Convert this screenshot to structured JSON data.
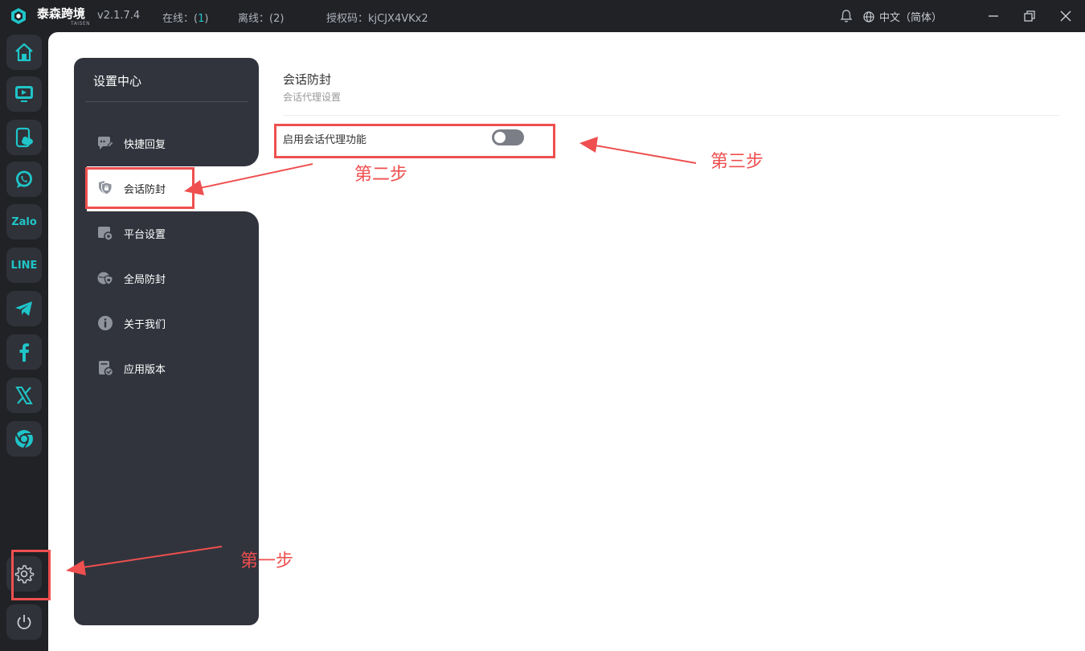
{
  "titlebar": {
    "brand": "泰森跨境",
    "brand_sub": "TAISEN",
    "version": "v2.1.7.4",
    "online_label": "在线：(",
    "online_count": "1",
    "online_close": ")",
    "offline_label": "离线：(2)",
    "license": "授权码：kjCJX4VKx2",
    "language": "中文（简体）"
  },
  "rail": {
    "items": [
      {
        "name": "home-icon"
      },
      {
        "name": "monitor-icon"
      },
      {
        "name": "cloud-phone-icon"
      },
      {
        "name": "whatsapp-icon"
      },
      {
        "label": "Zalo"
      },
      {
        "label": "LINE"
      },
      {
        "name": "telegram-icon"
      },
      {
        "name": "facebook-icon"
      },
      {
        "name": "x-icon"
      },
      {
        "name": "chrome-icon"
      }
    ]
  },
  "settings_menu": {
    "title": "设置中心",
    "items": [
      {
        "label": "快捷回复",
        "icon": "chat-reply-icon"
      },
      {
        "label": "会话防封",
        "icon": "shield-lock-icon",
        "active": true
      },
      {
        "label": "平台设置",
        "icon": "platform-gear-icon"
      },
      {
        "label": "全局防封",
        "icon": "globe-shield-icon"
      },
      {
        "label": "关于我们",
        "icon": "info-icon"
      },
      {
        "label": "应用版本",
        "icon": "version-icon"
      }
    ]
  },
  "content": {
    "title": "会话防封",
    "subtitle": "会话代理设置",
    "toggle_label": "启用会话代理功能",
    "toggle_on": false
  },
  "annotations": {
    "step1": "第一步",
    "step2": "第二步",
    "step3": "第三步",
    "color": "#ef4f4f"
  },
  "colors": {
    "accent": "#1fc5c9",
    "sidebar": "#31343d",
    "background": "#202226"
  }
}
